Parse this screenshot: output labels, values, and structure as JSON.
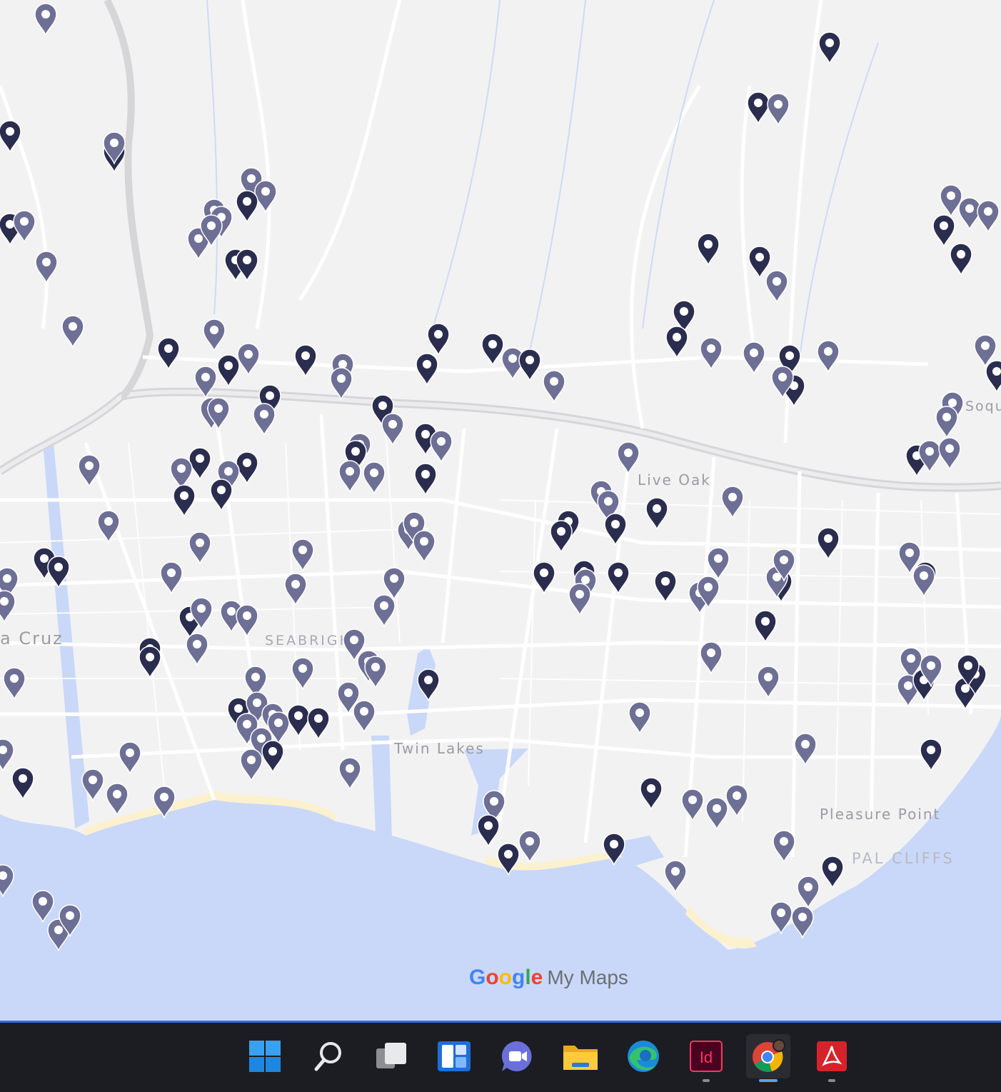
{
  "map": {
    "labels": {
      "live_oak": "Live Oak",
      "santa_cruz": "a Cruz",
      "seabright": "SEABRIGHT",
      "twin_lakes": "Twin Lakes",
      "pleasure_point": "Pleasure Point",
      "opal_cliffs": "PAL CLIFFS",
      "soquel": "Soqu"
    },
    "attribution": {
      "google": "Google",
      "product": "My Maps"
    },
    "marker_colors": {
      "dark": "#2b2d4f",
      "light": "#6e6f95"
    },
    "water_color": "#c9d8f8",
    "beach_color": "#fbf1cf"
  },
  "taskbar": {
    "items": [
      {
        "name": "start-button",
        "icon": "windows-logo-icon"
      },
      {
        "name": "search-button",
        "icon": "search-icon"
      },
      {
        "name": "task-view-button",
        "icon": "task-view-icon"
      },
      {
        "name": "widgets-button",
        "icon": "widgets-icon"
      },
      {
        "name": "chat-button",
        "icon": "teams-chat-icon"
      },
      {
        "name": "file-explorer-button",
        "icon": "folder-icon"
      },
      {
        "name": "edge-button",
        "icon": "edge-icon"
      },
      {
        "name": "indesign-button",
        "icon": "indesign-icon",
        "text": "Id"
      },
      {
        "name": "chrome-button",
        "icon": "chrome-icon",
        "active": true
      },
      {
        "name": "acrobat-button",
        "icon": "acrobat-icon"
      }
    ]
  }
}
